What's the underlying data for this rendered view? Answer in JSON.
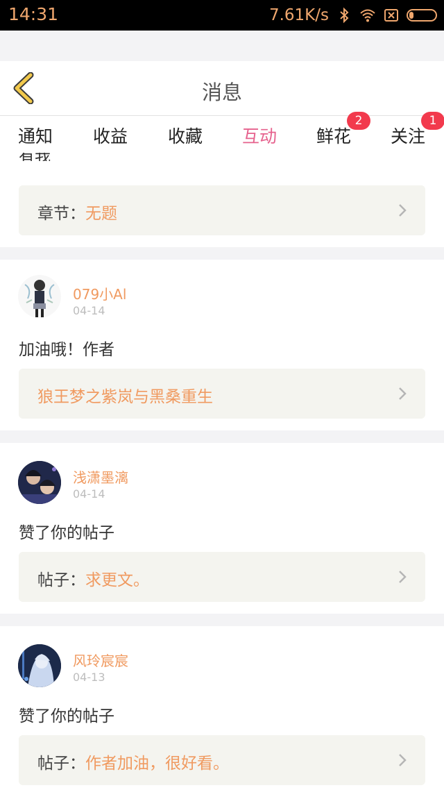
{
  "status_bar": {
    "time": "14:31",
    "net_speed": "7.61K/s",
    "icons": [
      "bluetooth-icon",
      "wifi-icon",
      "sim-icon",
      "battery-icon"
    ],
    "battery_level": 0.18
  },
  "navbar": {
    "title": "消息"
  },
  "tabs": [
    {
      "label": "通知",
      "badge": ""
    },
    {
      "label": "收益",
      "badge": ""
    },
    {
      "label": "收藏",
      "badge": ""
    },
    {
      "label": "互动",
      "badge": "",
      "active": true
    },
    {
      "label": "鲜花",
      "badge": "2"
    },
    {
      "label": "关注",
      "badge": "1"
    }
  ],
  "partial_item": {
    "message_fragment": "有我",
    "ref_label": "章节：",
    "ref_value": "无题"
  },
  "items": [
    {
      "username": "079小Al",
      "date": "04-14",
      "message": "加油哦！作者",
      "ref_label": "",
      "ref_value": "狼王梦之紫岚与黑桑重生"
    },
    {
      "username": "浅潇墨漓",
      "date": "04-14",
      "message": "赞了你的帖子",
      "ref_label": "帖子：",
      "ref_value": "求更文。"
    },
    {
      "username": "风玲宸宸",
      "date": "04-13",
      "message": "赞了你的帖子",
      "ref_label": "帖子：",
      "ref_value": "作者加油，很好看。"
    }
  ],
  "colors": {
    "accent": "#e6628e",
    "username": "#f09a60",
    "badge": "#f23a4d",
    "back_icon": "#f2c94c"
  }
}
